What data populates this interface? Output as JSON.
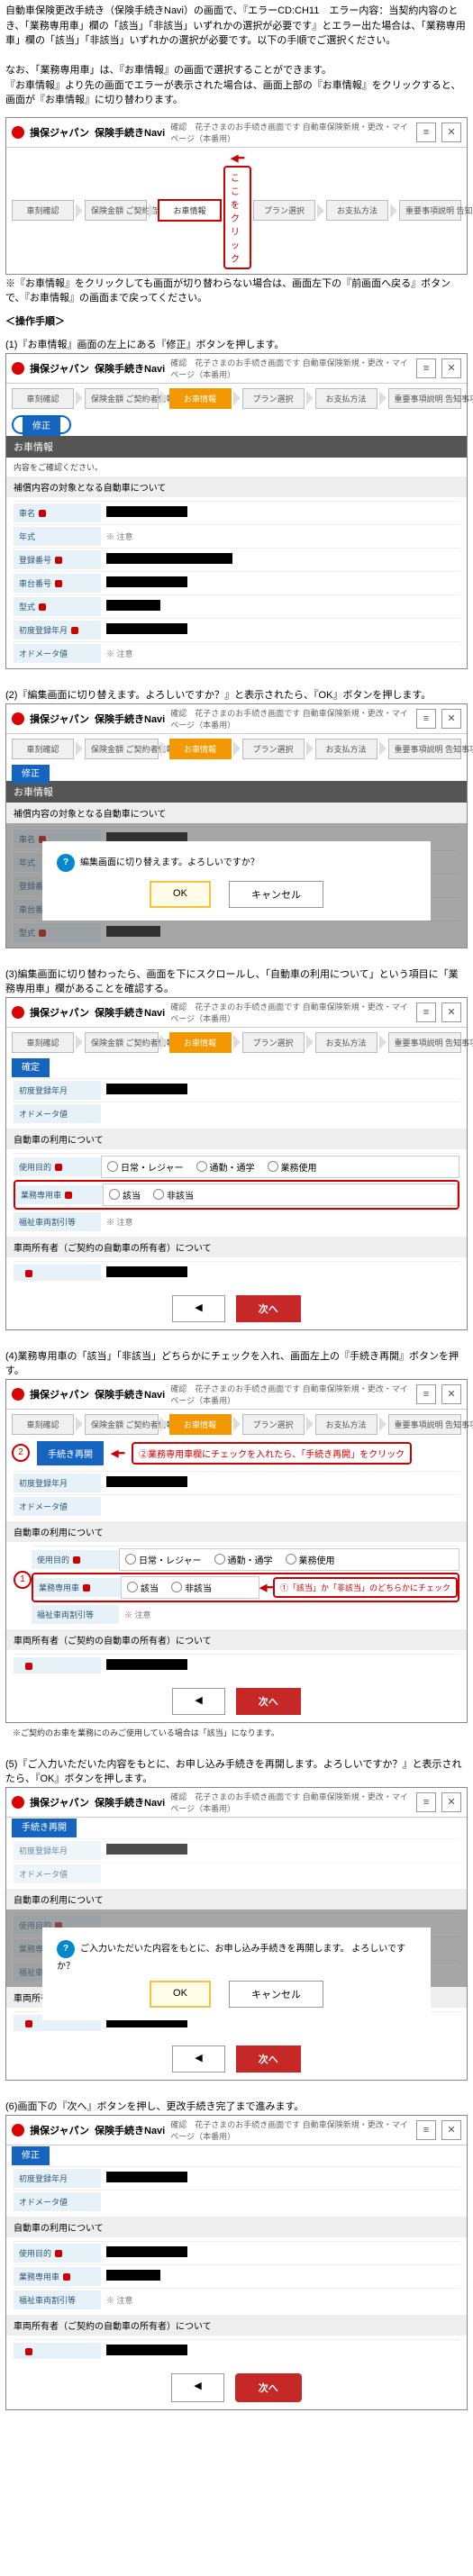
{
  "intro": {
    "p1": "自動車保険更改手続き（保険手続きNavi）の画面で、『エラーCD:CH11　エラー内容：当契約内容のとき、「業務専用車」欄の「該当」「非該当」いずれかの選択が必要です』とエラー出た場合は、「業務専用車」欄の「該当」「非該当」いずれかの選択が必要です。以下の手順でご選択ください。",
    "p2": "なお、「業務専用車」は、『お車情報』の画面で選択することができます。",
    "p3": "『お車情報』より先の画面でエラーが表示された場合は、画面上部の『お車情報』をクリックすると、画面が『お車情報』に切り替わります。"
  },
  "app": {
    "brand": "損保ジャパン",
    "title": "保険手続きNavi",
    "info": "確認　花子さまのお手続き画面です\n自動車保険新規・更改・マイページ（本番用）",
    "menu_icon": "≡",
    "close_icon": "✕"
  },
  "tabs": {
    "t1": "車刻確認",
    "t2": "保険金額\nご契約者情報等",
    "t3": "お車情報",
    "t4": "プラン選択",
    "t5": "お支払方法",
    "t6": "重要事項説明\n告知事項等"
  },
  "callout_click": "ここをクリック",
  "note_under_shot1": "※『お車情報』をクリックしても画面が切り替わらない場合は、画面左下の『前画面へ戻る』ボタンで、『お車情報』の画面まで戻ってください。",
  "ops_header": "＜操作手順＞",
  "step1": "(1)『お車情報』画面の左上にある『修正』ボタンを押します。",
  "btn_modify": "修正",
  "banner_car": "お車情報",
  "light_banner_1": "補償内容の対象となる自動車について",
  "info_required": "内容をご確認ください。",
  "light_banner_2": "補償内容の対象となる自動車について",
  "fields": {
    "plate": "車名",
    "year": "年式",
    "reg": "登録番号",
    "chassis": "車台番号",
    "model": "型式",
    "first_reg": "初度登録年月",
    "meter": "オドメータ値",
    "note": "※ 注意"
  },
  "step2": "(2)『編集画面に切り替えます。よろしいですか？』と表示されたら、『OK』ボタンを押します。",
  "btn_confirm_blue": "確定",
  "modal1": {
    "text": "編集画面に切り替えます。よろしいですか？",
    "ok": "OK",
    "cancel": "キャンセル"
  },
  "step3": "(3)編集画面に切り替わったら、画面を下にスクロールし、「自動車の利用について」という項目に「業務専用車」欄があることを確認する。",
  "section_use": "自動車の利用について",
  "use_fields": {
    "purpose": "使用目的",
    "purpose_opts": [
      "日常・レジャー",
      "通勤・通学",
      "業務使用"
    ],
    "biz_car": "業務専用車",
    "biz_opts": [
      "該当",
      "非該当"
    ],
    "rental": "福祉車両割引等"
  },
  "owner_section": "車両所有者（ご契約の自動車の所有者）について",
  "btn_next": "次へ",
  "step4": "(4)業務専用車の「該当」「非該当」どちらかにチェックを入れ、画面左上の『手続き再開』ボタンを押す。",
  "btn_restart": "手続き再開",
  "callout_restart": "②業務専用車欄にチェックを入れたら、「手続き再開」をクリック",
  "callout_select": "①「該当」か「非該当」のどちらかにチェック",
  "note_under_shot4": "※ご契約のお車を業務にのみご使用している場合は「該当」になります。",
  "step5": "(5)『ご入力いただいた内容をもとに、お申し込み手続きを再開します。よろしいですか？』と表示されたら、『OK』ボタンを押します。",
  "modal2": {
    "text": "ご入力いただいた内容をもとに、お申し込み手続きを再開します。\nよろしいですか？",
    "ok": "OK",
    "cancel": "キャンセル"
  },
  "step6": "(6)画面下の『次へ』ボタンを押し、更改手続き完了まで進みます。"
}
